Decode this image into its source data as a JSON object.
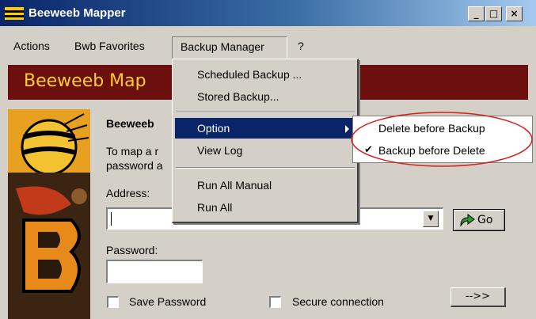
{
  "window": {
    "title": "Beeweeb Mapper"
  },
  "menubar": {
    "items": [
      {
        "label": "Actions"
      },
      {
        "label": "Bwb Favorites"
      },
      {
        "label": "Backup Manager"
      },
      {
        "label": "?"
      }
    ]
  },
  "banner": {
    "title": "Beeweeb Map"
  },
  "body": {
    "heading": "Beeweeb",
    "desc_line1": "To map a r",
    "desc_line2": "password a",
    "address_label": "Address:",
    "go_label": "Go",
    "password_label": "Password:",
    "save_password": "Save Password",
    "secure_connection": "Secure connection",
    "next_label": "-->>"
  },
  "backup_menu": {
    "items": [
      {
        "label": "Scheduled Backup ..."
      },
      {
        "label": "Stored Backup..."
      },
      {
        "label": "Option"
      },
      {
        "label": "View Log"
      },
      {
        "label": "Run All Manual"
      },
      {
        "label": "Run All"
      }
    ],
    "highlighted": "Option"
  },
  "option_submenu": {
    "items": [
      {
        "label": "Delete before Backup",
        "checked": false
      },
      {
        "label": "Backup before Delete",
        "checked": true
      }
    ]
  },
  "colors": {
    "title_bar": "#0a246a",
    "banner": "#6b0f0f",
    "banner_text": "#ffcc33",
    "highlight": "#0a246a",
    "annotation": "#d62020"
  }
}
